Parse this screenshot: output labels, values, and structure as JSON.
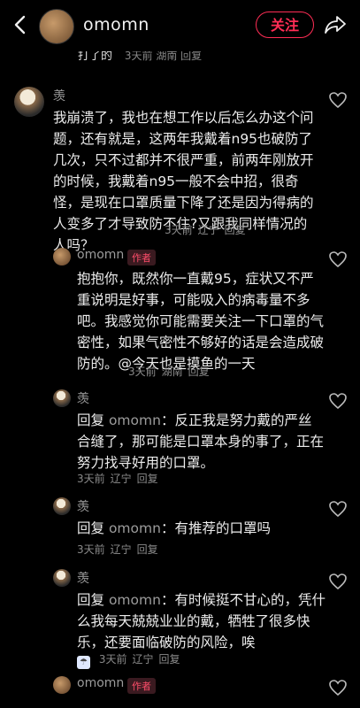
{
  "header": {
    "username": "omomn",
    "follow_label": "关注"
  },
  "partial_row": {
    "text": "打了的",
    "time": "3天前",
    "location": "湖南",
    "reply": "回复"
  },
  "comments": [
    {
      "user": "羡",
      "text": "我崩溃了，我也在想工作以后怎么办这个问题，还有就是，这两年我戴着n95也破防了几次，只不过都并不很严重，前两年刚放开的时候，我戴着n95一般不会中招，很奇怪，是现在口罩质量下降了还是因为得病的人变多了才导致防不住?又跟我同样情况的人吗？",
      "time": "3天前",
      "location": "辽宁",
      "reply": "回复"
    },
    {
      "user": "omomn",
      "tag": "作者",
      "text": "抱抱你，既然你一直戴95，症状又不严重说明是好事，可能吸入的病毒量不多吧。我感觉你可能需要关注一下口罩的气密性，如果气密性不够好的话是会造成破防的。@今天也是摸鱼的一天",
      "time": "3天前",
      "location": "湖南",
      "reply": "回复"
    },
    {
      "user": "羡",
      "reply_prefix": "回复",
      "reply_to": "omomn",
      "text": "：反正我是努力戴的严丝合缝了，那可能是口罩本身的事了，正在努力找寻好用的口罩。",
      "time": "3天前",
      "location": "辽宁",
      "reply": "回复"
    },
    {
      "user": "羡",
      "reply_prefix": "回复",
      "reply_to": "omomn",
      "text": "：有推荐的口罩吗",
      "time": "3天前",
      "location": "辽宁",
      "reply": "回复"
    },
    {
      "user": "羡",
      "reply_prefix": "回复",
      "reply_to": "omomn",
      "text": "：有时候挺不甘心的，凭什么我每天兢兢业业的戴，牺牲了很多快乐，还要面临破防的风险，唉",
      "time": "3天前",
      "location": "辽宁",
      "reply": "回复"
    },
    {
      "user": "omomn",
      "tag": "作者"
    }
  ],
  "icons": {
    "back": "back-icon",
    "share": "share-icon",
    "like": "heart-icon"
  },
  "colors": {
    "accent": "#ff2d55",
    "background": "#000000"
  }
}
